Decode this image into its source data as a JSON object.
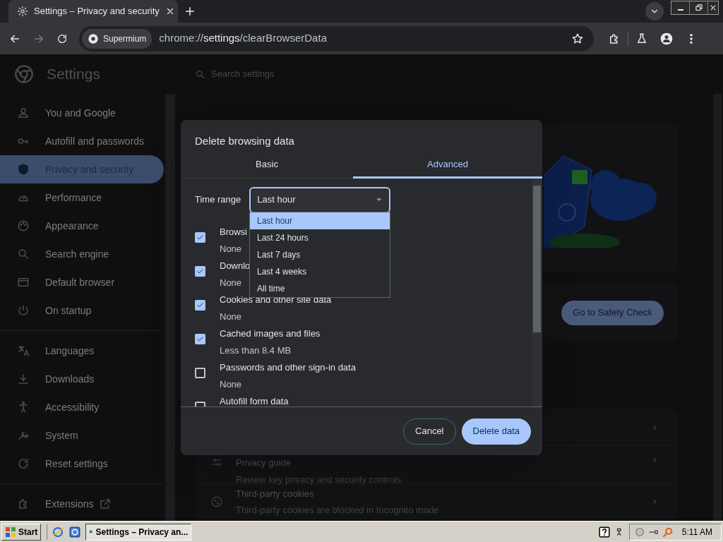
{
  "browser": {
    "tabs": [
      {
        "title": "Settings – Privacy and security",
        "selected": true
      }
    ],
    "site_chip": "Supermium",
    "url": "chrome://**settings**/clearBrowserData"
  },
  "settings_header": {
    "title": "Settings",
    "search_placeholder": "Search settings"
  },
  "sidebar": {
    "groups": [
      {
        "items": [
          {
            "label": "You and Google",
            "selected": false
          },
          {
            "label": "Autofill and passwords",
            "selected": false
          },
          {
            "label": "Privacy and security",
            "selected": true
          },
          {
            "label": "Performance",
            "selected": false
          },
          {
            "label": "Appearance",
            "selected": false
          },
          {
            "label": "Search engine",
            "selected": false
          },
          {
            "label": "Default browser",
            "selected": false
          },
          {
            "label": "On startup",
            "selected": false
          }
        ]
      },
      {
        "items": [
          {
            "label": "Languages",
            "selected": false
          },
          {
            "label": "Downloads",
            "selected": false
          },
          {
            "label": "Accessibility",
            "selected": false
          },
          {
            "label": "System",
            "selected": false
          },
          {
            "label": "Reset settings",
            "selected": false
          }
        ]
      },
      {
        "items": [
          {
            "label": "Extensions",
            "selected": false
          }
        ]
      }
    ]
  },
  "background": {
    "safety_check_button": "Go to Safety Check",
    "rows": [
      {
        "title": "Privacy guide",
        "subtitle": "Review key privacy and security controls"
      },
      {
        "title": "Third-party cookies",
        "subtitle": "Third-party cookies are blocked in Incognito mode"
      }
    ]
  },
  "dialog": {
    "title": "Delete browsing data",
    "tabs": [
      {
        "label": "Basic",
        "selected": false
      },
      {
        "label": "Advanced",
        "selected": true
      }
    ],
    "time_range": {
      "label": "Time range",
      "value": "Last hour",
      "expanded": true,
      "options": [
        {
          "label": "Last hour",
          "selected": true
        },
        {
          "label": "Last 24 hours",
          "selected": false
        },
        {
          "label": "Last 7 days",
          "selected": false
        },
        {
          "label": "Last 4 weeks",
          "selected": false
        },
        {
          "label": "All time",
          "selected": false
        }
      ]
    },
    "items": [
      {
        "title": "Browsi",
        "subtitle": "None",
        "checked": true
      },
      {
        "title": "Downlo",
        "subtitle": "None",
        "checked": true
      },
      {
        "title": "Cookies and other site data",
        "subtitle": "None",
        "checked": true
      },
      {
        "title": "Cached images and files",
        "subtitle": "Less than 8.4 MB",
        "checked": true
      },
      {
        "title": "Passwords and other sign-in data",
        "subtitle": "None",
        "checked": false
      },
      {
        "title": "Autofill form data",
        "checked": false
      }
    ],
    "buttons": [
      {
        "label": "Cancel",
        "kind": "secondary"
      },
      {
        "label": "Delete data",
        "kind": "primary"
      }
    ]
  },
  "taskbar": {
    "start": "Start",
    "tasks": [
      {
        "label": "Settings – Privacy an...",
        "selected": true
      }
    ],
    "clock": "5:11 AM"
  }
}
